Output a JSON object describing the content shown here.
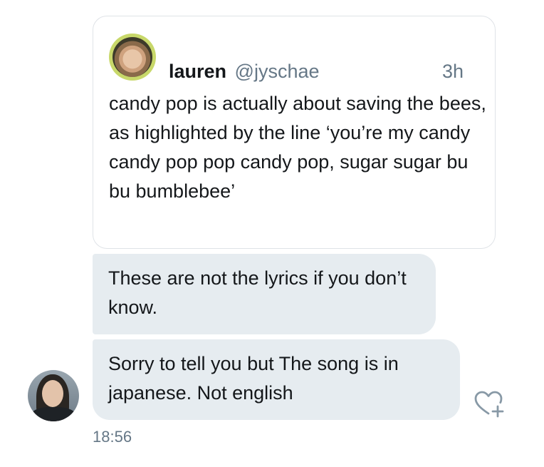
{
  "quoted_tweet": {
    "author_name": "lauren",
    "author_handle": "@jyschae",
    "time_ago": "3h",
    "text": "candy pop is actually about saving the bees, as highlighted by the line ‘you’re my candy candy pop pop candy pop, sugar sugar bu bu bumblebee’"
  },
  "messages": [
    {
      "text": "These are not the lyrics if you don’t know."
    },
    {
      "text": "Sorry to tell you but The song is in japanese. Not english"
    }
  ],
  "timestamp": "18:56",
  "icons": {
    "like": "heart-plus-icon"
  },
  "colors": {
    "bubble_background": "#e6ecf0",
    "secondary_text": "#657786",
    "primary_text": "#14171a",
    "avatar_ring": "#c8d86a"
  }
}
